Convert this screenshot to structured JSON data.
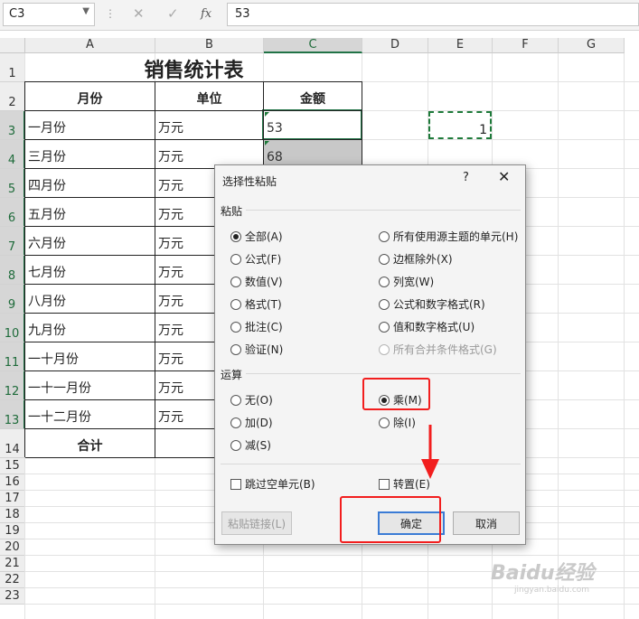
{
  "formula_bar": {
    "name_box": "C3",
    "cancel_icon": "✕",
    "enter_icon": "✓",
    "fx_label": "fx",
    "value": "53"
  },
  "columns": [
    "A",
    "B",
    "C",
    "D",
    "E",
    "F",
    "G"
  ],
  "rows": [
    "1",
    "2",
    "3",
    "4",
    "5",
    "6",
    "7",
    "8",
    "9",
    "10",
    "11",
    "12",
    "13",
    "14",
    "15",
    "16",
    "17",
    "18",
    "19",
    "20",
    "21",
    "22",
    "23"
  ],
  "sheet": {
    "title": "销售统计表",
    "headers": {
      "month": "月份",
      "unit": "单位",
      "amount": "金额"
    },
    "data_rows": [
      {
        "month": "一月份",
        "unit": "万元",
        "amount": "53"
      },
      {
        "month": "三月份",
        "unit": "万元",
        "amount": "68"
      },
      {
        "month": "四月份",
        "unit": "万元",
        "amount": ""
      },
      {
        "month": "五月份",
        "unit": "万元",
        "amount": ""
      },
      {
        "month": "六月份",
        "unit": "万元",
        "amount": ""
      },
      {
        "month": "七月份",
        "unit": "万元",
        "amount": ""
      },
      {
        "month": "八月份",
        "unit": "万元",
        "amount": ""
      },
      {
        "month": "九月份",
        "unit": "万元",
        "amount": ""
      },
      {
        "month": "一十月份",
        "unit": "万元",
        "amount": ""
      },
      {
        "month": "一十一月份",
        "unit": "万元",
        "amount": ""
      },
      {
        "month": "一十二月份",
        "unit": "万元",
        "amount": ""
      }
    ],
    "total_label": "合计",
    "copied_cell_value": "1"
  },
  "dialog": {
    "title": "选择性粘贴",
    "help": "?",
    "close": "✕",
    "paste_section": "粘贴",
    "paste_options_left": [
      {
        "label": "全部(A)",
        "checked": true
      },
      {
        "label": "公式(F)",
        "checked": false
      },
      {
        "label": "数值(V)",
        "checked": false
      },
      {
        "label": "格式(T)",
        "checked": false
      },
      {
        "label": "批注(C)",
        "checked": false
      },
      {
        "label": "验证(N)",
        "checked": false
      }
    ],
    "paste_options_right": [
      {
        "label": "所有使用源主题的单元(H)",
        "checked": false
      },
      {
        "label": "边框除外(X)",
        "checked": false
      },
      {
        "label": "列宽(W)",
        "checked": false
      },
      {
        "label": "公式和数字格式(R)",
        "checked": false
      },
      {
        "label": "值和数字格式(U)",
        "checked": false
      },
      {
        "label": "所有合并条件格式(G)",
        "checked": false,
        "disabled": true
      }
    ],
    "operation_section": "运算",
    "operation_left": [
      {
        "label": "无(O)",
        "checked": false
      },
      {
        "label": "加(D)",
        "checked": false
      },
      {
        "label": "减(S)",
        "checked": false
      }
    ],
    "operation_right": [
      {
        "label": "乘(M)",
        "checked": true
      },
      {
        "label": "除(I)",
        "checked": false
      }
    ],
    "skip_blanks": "跳过空单元(B)",
    "transpose": "转置(E)",
    "paste_link": "粘贴链接(L)",
    "ok": "确定",
    "cancel": "取消"
  },
  "annotation_color": "#f21e1e",
  "watermark": {
    "main": "Baidu经验",
    "sub": "jingyan.baidu.com"
  }
}
